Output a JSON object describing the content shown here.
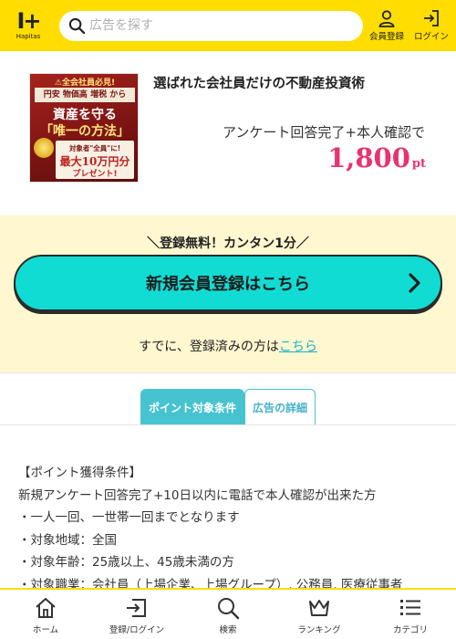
{
  "header": {
    "logo_mark": "I+",
    "logo_text": "Hapitas",
    "search_placeholder": "広告を探す",
    "register_label": "会員登録",
    "login_label": "ログイン",
    "bg_color": "#ffdd00"
  },
  "ad": {
    "image": {
      "line1": "⚠全会社員必見!",
      "line2": "円安 物価高 増税 から",
      "line3": "資産を守る",
      "line4": "「唯一の方法」",
      "line5a": "対象者\"全員\"に!",
      "line5b": "最大10万円分",
      "line5c": "プレゼント!"
    },
    "title": "選ばれた会社員だけの不動産投資術",
    "condition": "アンケート回答完了+本人確認で",
    "points_value": "1,800",
    "points_unit": "pt",
    "points_color": "#e8336f"
  },
  "registration": {
    "free_text": "＼登録無料！カンタン1分／",
    "button_label": "新規会員登録はこちら",
    "already_text": "すでに、登録済みの方は",
    "already_link": "こちら",
    "button_color": "#11dcd3"
  },
  "tabs": [
    {
      "label": "ポイント対象条件",
      "active": true
    },
    {
      "label": "広告の詳細",
      "active": false
    }
  ],
  "conditions": [
    "【ポイント獲得条件】",
    "新規アンケート回答完了+10日以内に電話で本人確認が出来た方",
    "・一人一回、一世帯一回までとなります",
    "・対象地域：全国",
    "・対象年齢：25歳以上、45歳未満の方",
    "・対象職業：会社員（上場企業、上場グループ）, 公務員, 医療従事者"
  ],
  "bottom_nav": [
    {
      "label": "ホーム",
      "icon": "home-icon"
    },
    {
      "label": "登録/ログイン",
      "icon": "login-icon"
    },
    {
      "label": "検索",
      "icon": "search-icon"
    },
    {
      "label": "ランキング",
      "icon": "crown-icon"
    },
    {
      "label": "カテゴリ",
      "icon": "list-icon"
    }
  ]
}
